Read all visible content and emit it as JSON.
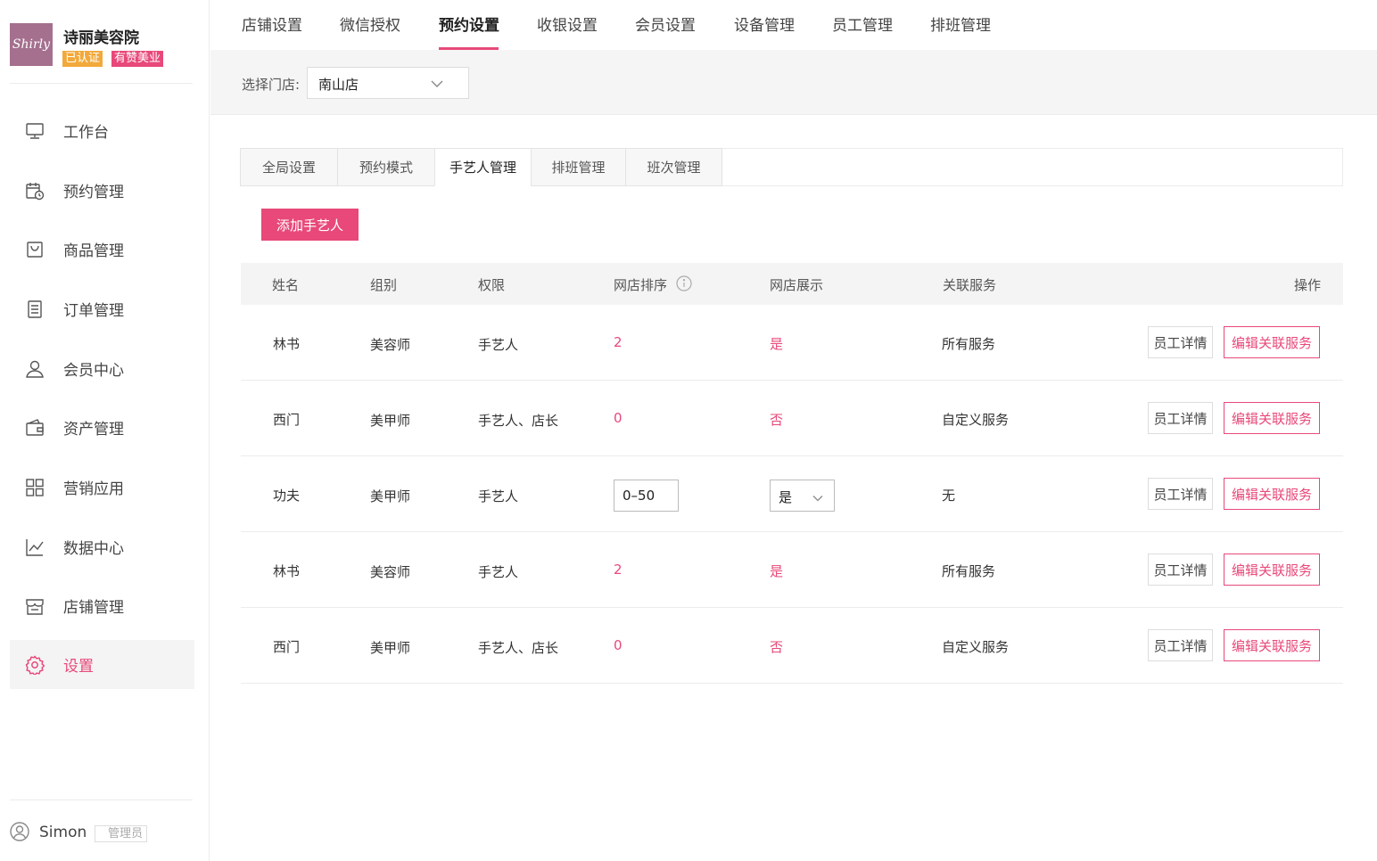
{
  "brand": {
    "logo_text": "Shirly",
    "name": "诗丽美容院",
    "badge_verified": "已认证",
    "badge_youzan": "有赞美业"
  },
  "sidebar": {
    "items": [
      {
        "label": "工作台",
        "icon": "monitor-icon"
      },
      {
        "label": "预约管理",
        "icon": "calendar-clock-icon"
      },
      {
        "label": "商品管理",
        "icon": "bag-icon"
      },
      {
        "label": "订单管理",
        "icon": "document-icon"
      },
      {
        "label": "会员中心",
        "icon": "person-icon"
      },
      {
        "label": "资产管理",
        "icon": "wallet-icon"
      },
      {
        "label": "营销应用",
        "icon": "grid-icon"
      },
      {
        "label": "数据中心",
        "icon": "chart-line-icon"
      },
      {
        "label": "店铺管理",
        "icon": "store-icon"
      },
      {
        "label": "设置",
        "icon": "gear-icon",
        "active": true
      }
    ]
  },
  "user": {
    "name": "Simon",
    "role": "管理员"
  },
  "top_tabs": {
    "items": [
      "店铺设置",
      "微信授权",
      "预约设置",
      "收银设置",
      "会员设置",
      "设备管理",
      "员工管理",
      "排班管理"
    ],
    "active": "预约设置"
  },
  "store": {
    "label": "选择门店:",
    "selected": "南山店"
  },
  "sub_tabs": {
    "items": [
      "全局设置",
      "预约模式",
      "手艺人管理",
      "排班管理",
      "班次管理"
    ],
    "active": "手艺人管理"
  },
  "add_button": "添加手艺人",
  "table": {
    "headers": [
      "姓名",
      "组别",
      "权限",
      "网店排序",
      "网店展示",
      "关联服务",
      "操作"
    ],
    "rows": [
      {
        "name": "林书",
        "group": "美容师",
        "permission": "手艺人",
        "rank": "2",
        "show": "是",
        "service": "所有服务"
      },
      {
        "name": "西门",
        "group": "美甲师",
        "permission": "手艺人、店长",
        "rank": "0",
        "show": "否",
        "service": "自定义服务"
      },
      {
        "name": "功夫",
        "group": "美甲师",
        "permission": "手艺人",
        "rank_input": "0–50",
        "show_select": "是",
        "service": "无"
      },
      {
        "name": "林书",
        "group": "美容师",
        "permission": "手艺人",
        "rank": "2",
        "show": "是",
        "service": "所有服务"
      },
      {
        "name": "西门",
        "group": "美甲师",
        "permission": "手艺人、店长",
        "rank": "0",
        "show": "否",
        "service": "自定义服务"
      }
    ],
    "detail_button": "员工详情",
    "edit_button": "编辑关联服务"
  },
  "colors": {
    "accent": "#e8497a",
    "badge_orange": "#f2a93b",
    "logo_bg": "#a4708e"
  }
}
